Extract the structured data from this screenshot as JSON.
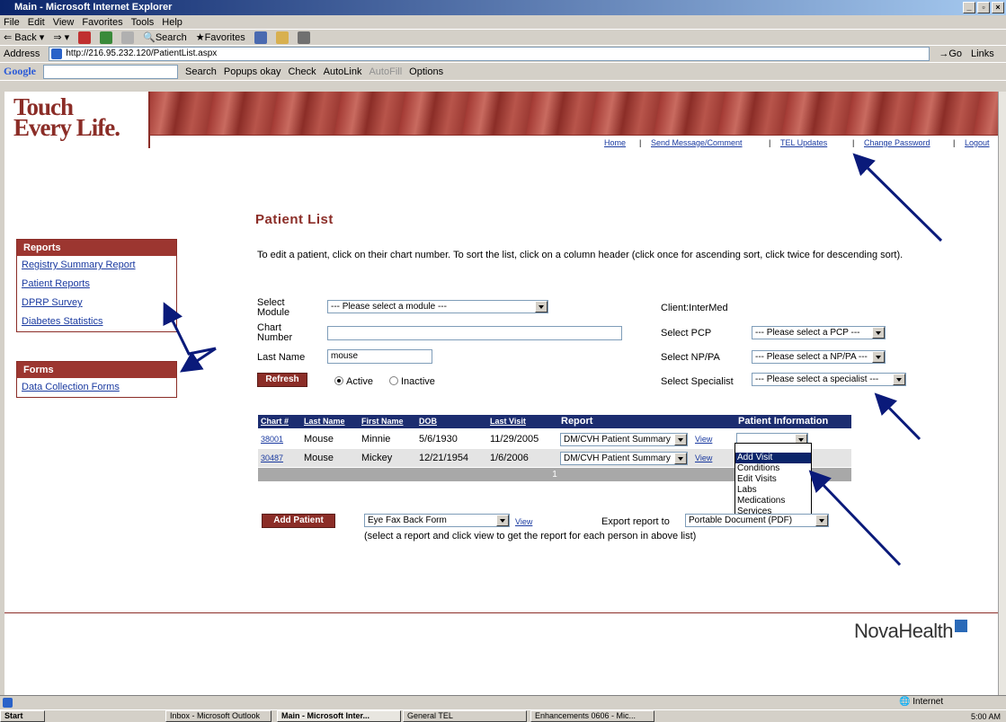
{
  "window": {
    "title": "Main - Microsoft Internet Explorer"
  },
  "menubar": [
    "File",
    "Edit",
    "View",
    "Favorites",
    "Tools",
    "Help"
  ],
  "toolbar": {
    "back": "Back",
    "search": "Search",
    "favorites": "Favorites"
  },
  "address": {
    "label": "Address",
    "url": "http://216.95.232.120/PatientList.aspx",
    "go": "Go",
    "links": "Links"
  },
  "google_bar": {
    "brand": "Google",
    "search": "Search",
    "popups": "Popups okay",
    "check": "Check",
    "autolink": "AutoLink",
    "autofill": "AutoFill",
    "options": "Options"
  },
  "banner": {
    "logo_line1": "Touch",
    "logo_line2": "Every Life."
  },
  "nav": {
    "home": "Home",
    "send": "Send Message/Comment",
    "updates": "TEL Updates",
    "password": "Change Password",
    "logout": "Logout"
  },
  "sidebar": {
    "reports": {
      "title": "Reports",
      "items": [
        "Registry Summary Report",
        "Patient Reports",
        "DPRP Survey",
        "Diabetes Statistics"
      ]
    },
    "forms": {
      "title": "Forms",
      "items": [
        "Data Collection Forms"
      ]
    }
  },
  "main": {
    "title": "Patient List",
    "instructions": "To edit a patient, click on their chart number. To sort the list, click on a column header (click once for ascending sort, click twice for descending sort).",
    "module_label1": "Select",
    "module_label2": "Module",
    "module_value": "--- Please select a module ---",
    "chart_label1": "Chart",
    "chart_label2": "Number",
    "chart_value": "",
    "lastname_label": "Last Name",
    "lastname_value": "mouse",
    "refresh": "Refresh",
    "active": "Active",
    "inactive": "Inactive",
    "client": "Client:InterMed",
    "pcp_label": "Select PCP",
    "pcp_value": "--- Please select a PCP ---",
    "np_label": "Select NP/PA",
    "np_value": "--- Please select a NP/PA ---",
    "spec_label": "Select Specialist",
    "spec_value": "--- Please select a specialist ---"
  },
  "table": {
    "headers": [
      "Chart #",
      "Last Name",
      "First Name",
      "DOB",
      "Last Visit",
      "Report",
      "Patient Information"
    ],
    "rows": [
      {
        "chart": "38001",
        "last": "Mouse",
        "first": "Minnie",
        "dob": "5/6/1930",
        "visit": "11/29/2005",
        "report": "DM/CVH Patient Summary",
        "view": "View"
      },
      {
        "chart": "30487",
        "last": "Mouse",
        "first": "Mickey",
        "dob": "12/21/1954",
        "visit": "1/6/2006",
        "report": "DM/CVH Patient Summary",
        "view": "View"
      }
    ],
    "page": "1",
    "dropdown_options": [
      "Add Visit",
      "Conditions",
      "Edit Visits",
      "Labs",
      "Medications",
      "Services"
    ]
  },
  "bottom": {
    "add_patient": "Add Patient",
    "form_select": "Eye Fax Back Form",
    "view": "View",
    "export_label": "Export report to",
    "export_value": "Portable Document (PDF)",
    "note": "(select a report and click view to get the report for each person in above list)"
  },
  "footer": {
    "brand": "NovaHealth"
  },
  "status": {
    "zone": "Internet"
  },
  "taskbar": {
    "start": "Start",
    "tasks": [
      "Inbox - Microsoft Outlook",
      "Main - Microsoft Inter...",
      "General TEL",
      "Enhancements 0606 - Mic..."
    ],
    "clock": "5:00 AM"
  },
  "colors": {
    "brand": "#8b2d27",
    "table_header": "#1c2d70",
    "arrow": "#0a1a7a"
  }
}
